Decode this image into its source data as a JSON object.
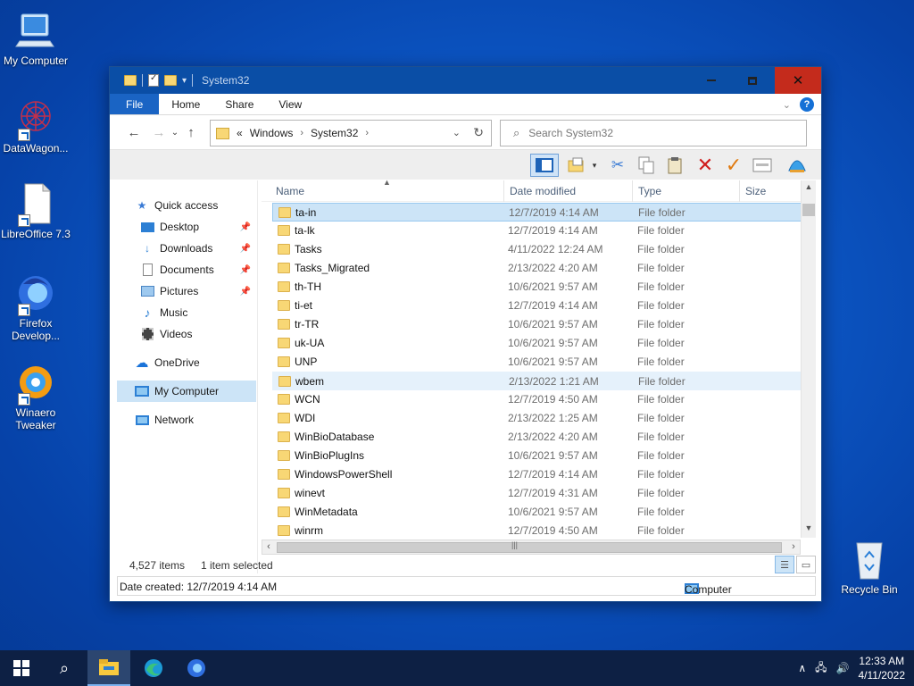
{
  "desktop": {
    "icons": [
      {
        "label": "My Computer",
        "icon": "monitor-icon"
      },
      {
        "label": "DataWagon...",
        "icon": "datawagon-icon"
      },
      {
        "label": "LibreOffice 7.3",
        "icon": "libreoffice-icon"
      },
      {
        "label": "Firefox Develop...",
        "icon": "firefox-developer-icon"
      },
      {
        "label": "Winaero Tweaker",
        "icon": "winaero-tweaker-icon"
      },
      {
        "label": "Recycle Bin",
        "icon": "recycle-bin-icon"
      }
    ]
  },
  "window": {
    "title": "System32",
    "ribbon_tabs": [
      "File",
      "Home",
      "Share",
      "View"
    ],
    "address": {
      "prefix": "«",
      "crumbs": [
        "Windows",
        "System32"
      ]
    },
    "search_placeholder": "Search System32",
    "columns": [
      "Name",
      "Date modified",
      "Type",
      "Size"
    ],
    "nav": {
      "quick_access": "Quick access",
      "items": [
        {
          "label": "Desktop",
          "icon": "desktop-icon",
          "pinned": true
        },
        {
          "label": "Downloads",
          "icon": "downloads-icon",
          "pinned": true
        },
        {
          "label": "Documents",
          "icon": "documents-icon",
          "pinned": true
        },
        {
          "label": "Pictures",
          "icon": "pictures-icon",
          "pinned": true
        },
        {
          "label": "Music",
          "icon": "music-icon",
          "pinned": false
        },
        {
          "label": "Videos",
          "icon": "videos-icon",
          "pinned": false
        }
      ],
      "onedrive": "OneDrive",
      "my_computer": "My Computer",
      "network": "Network"
    },
    "files": [
      {
        "name": "ta-in",
        "date": "12/7/2019 4:14 AM",
        "type": "File folder",
        "state": "selected"
      },
      {
        "name": "ta-lk",
        "date": "12/7/2019 4:14 AM",
        "type": "File folder"
      },
      {
        "name": "Tasks",
        "date": "4/11/2022 12:24 AM",
        "type": "File folder"
      },
      {
        "name": "Tasks_Migrated",
        "date": "2/13/2022 4:20 AM",
        "type": "File folder"
      },
      {
        "name": "th-TH",
        "date": "10/6/2021 9:57 AM",
        "type": "File folder"
      },
      {
        "name": "ti-et",
        "date": "12/7/2019 4:14 AM",
        "type": "File folder"
      },
      {
        "name": "tr-TR",
        "date": "10/6/2021 9:57 AM",
        "type": "File folder"
      },
      {
        "name": "uk-UA",
        "date": "10/6/2021 9:57 AM",
        "type": "File folder"
      },
      {
        "name": "UNP",
        "date": "10/6/2021 9:57 AM",
        "type": "File folder"
      },
      {
        "name": "wbem",
        "date": "2/13/2022 1:21 AM",
        "type": "File folder",
        "state": "hover"
      },
      {
        "name": "WCN",
        "date": "12/7/2019 4:50 AM",
        "type": "File folder"
      },
      {
        "name": "WDI",
        "date": "2/13/2022 1:25 AM",
        "type": "File folder"
      },
      {
        "name": "WinBioDatabase",
        "date": "2/13/2022 4:20 AM",
        "type": "File folder"
      },
      {
        "name": "WinBioPlugIns",
        "date": "10/6/2021 9:57 AM",
        "type": "File folder"
      },
      {
        "name": "WindowsPowerShell",
        "date": "12/7/2019 4:14 AM",
        "type": "File folder"
      },
      {
        "name": "winevt",
        "date": "12/7/2019 4:31 AM",
        "type": "File folder"
      },
      {
        "name": "WinMetadata",
        "date": "10/6/2021 9:57 AM",
        "type": "File folder"
      },
      {
        "name": "winrm",
        "date": "12/7/2019 4:50 AM",
        "type": "File folder"
      }
    ],
    "status": {
      "count": "4,527 items",
      "selection": "1 item selected"
    },
    "details": {
      "created": "Date created: 12/7/2019 4:14 AM",
      "location": "Computer"
    }
  },
  "taskbar": {
    "apps": [
      "start-icon",
      "search-icon",
      "file-explorer-icon",
      "edge-icon",
      "firefox-developer-icon"
    ],
    "time": "12:33 AM",
    "date": "4/11/2022"
  },
  "colors": {
    "titlebar": "#0a4ea6",
    "close": "#c42b1c",
    "selection": "#cce4f7",
    "folder": "#f8d775"
  }
}
